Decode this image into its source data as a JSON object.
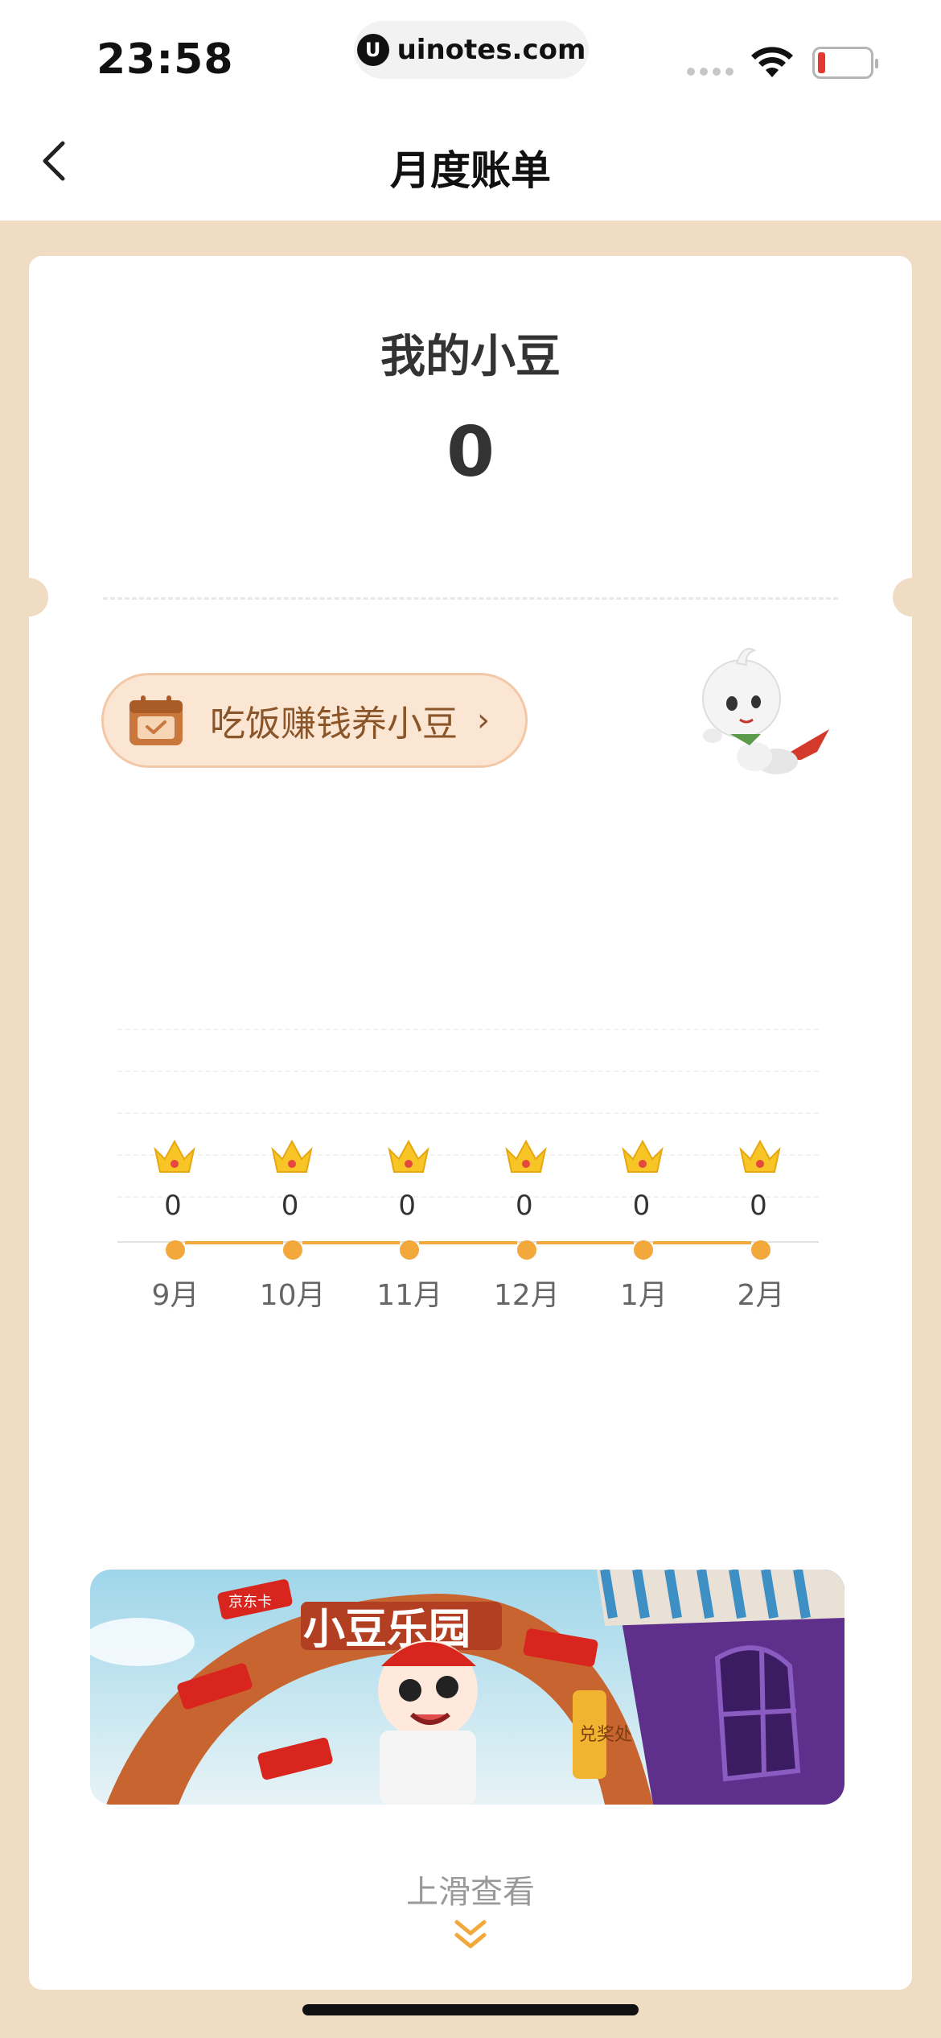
{
  "status_bar": {
    "time": "23:58",
    "url": "uinotes.com",
    "url_logo": "U",
    "battery_level": 0.1,
    "battery_color": "#e5392f"
  },
  "nav": {
    "back_icon": "chevron-left-icon",
    "title": "月度账单"
  },
  "summary": {
    "title": "我的小豆",
    "value": "0"
  },
  "earn_button": {
    "icon": "calendar-check-icon",
    "label": "吃饭赚钱养小豆",
    "arrow": "›"
  },
  "mascot": {
    "icon": "flying-mascot-icon"
  },
  "chart_data": {
    "type": "line",
    "categories": [
      "9月",
      "10月",
      "11月",
      "12月",
      "1月",
      "2月"
    ],
    "values": [
      0,
      0,
      0,
      0,
      0,
      0
    ],
    "marker_icon": "crown-icon",
    "line_color": "#f2a83b",
    "grid": true
  },
  "banner": {
    "title": "小豆乐园",
    "tag": "京东卡",
    "sign": "兑奖处"
  },
  "footer": {
    "scroll_hint": "上滑查看",
    "scroll_icon": "double-chevron-down-icon"
  },
  "colors": {
    "page_bg": "#efdcc2",
    "accent": "#f2a83b",
    "button_bg": "#fbe6d4",
    "button_text": "#8a5528"
  }
}
